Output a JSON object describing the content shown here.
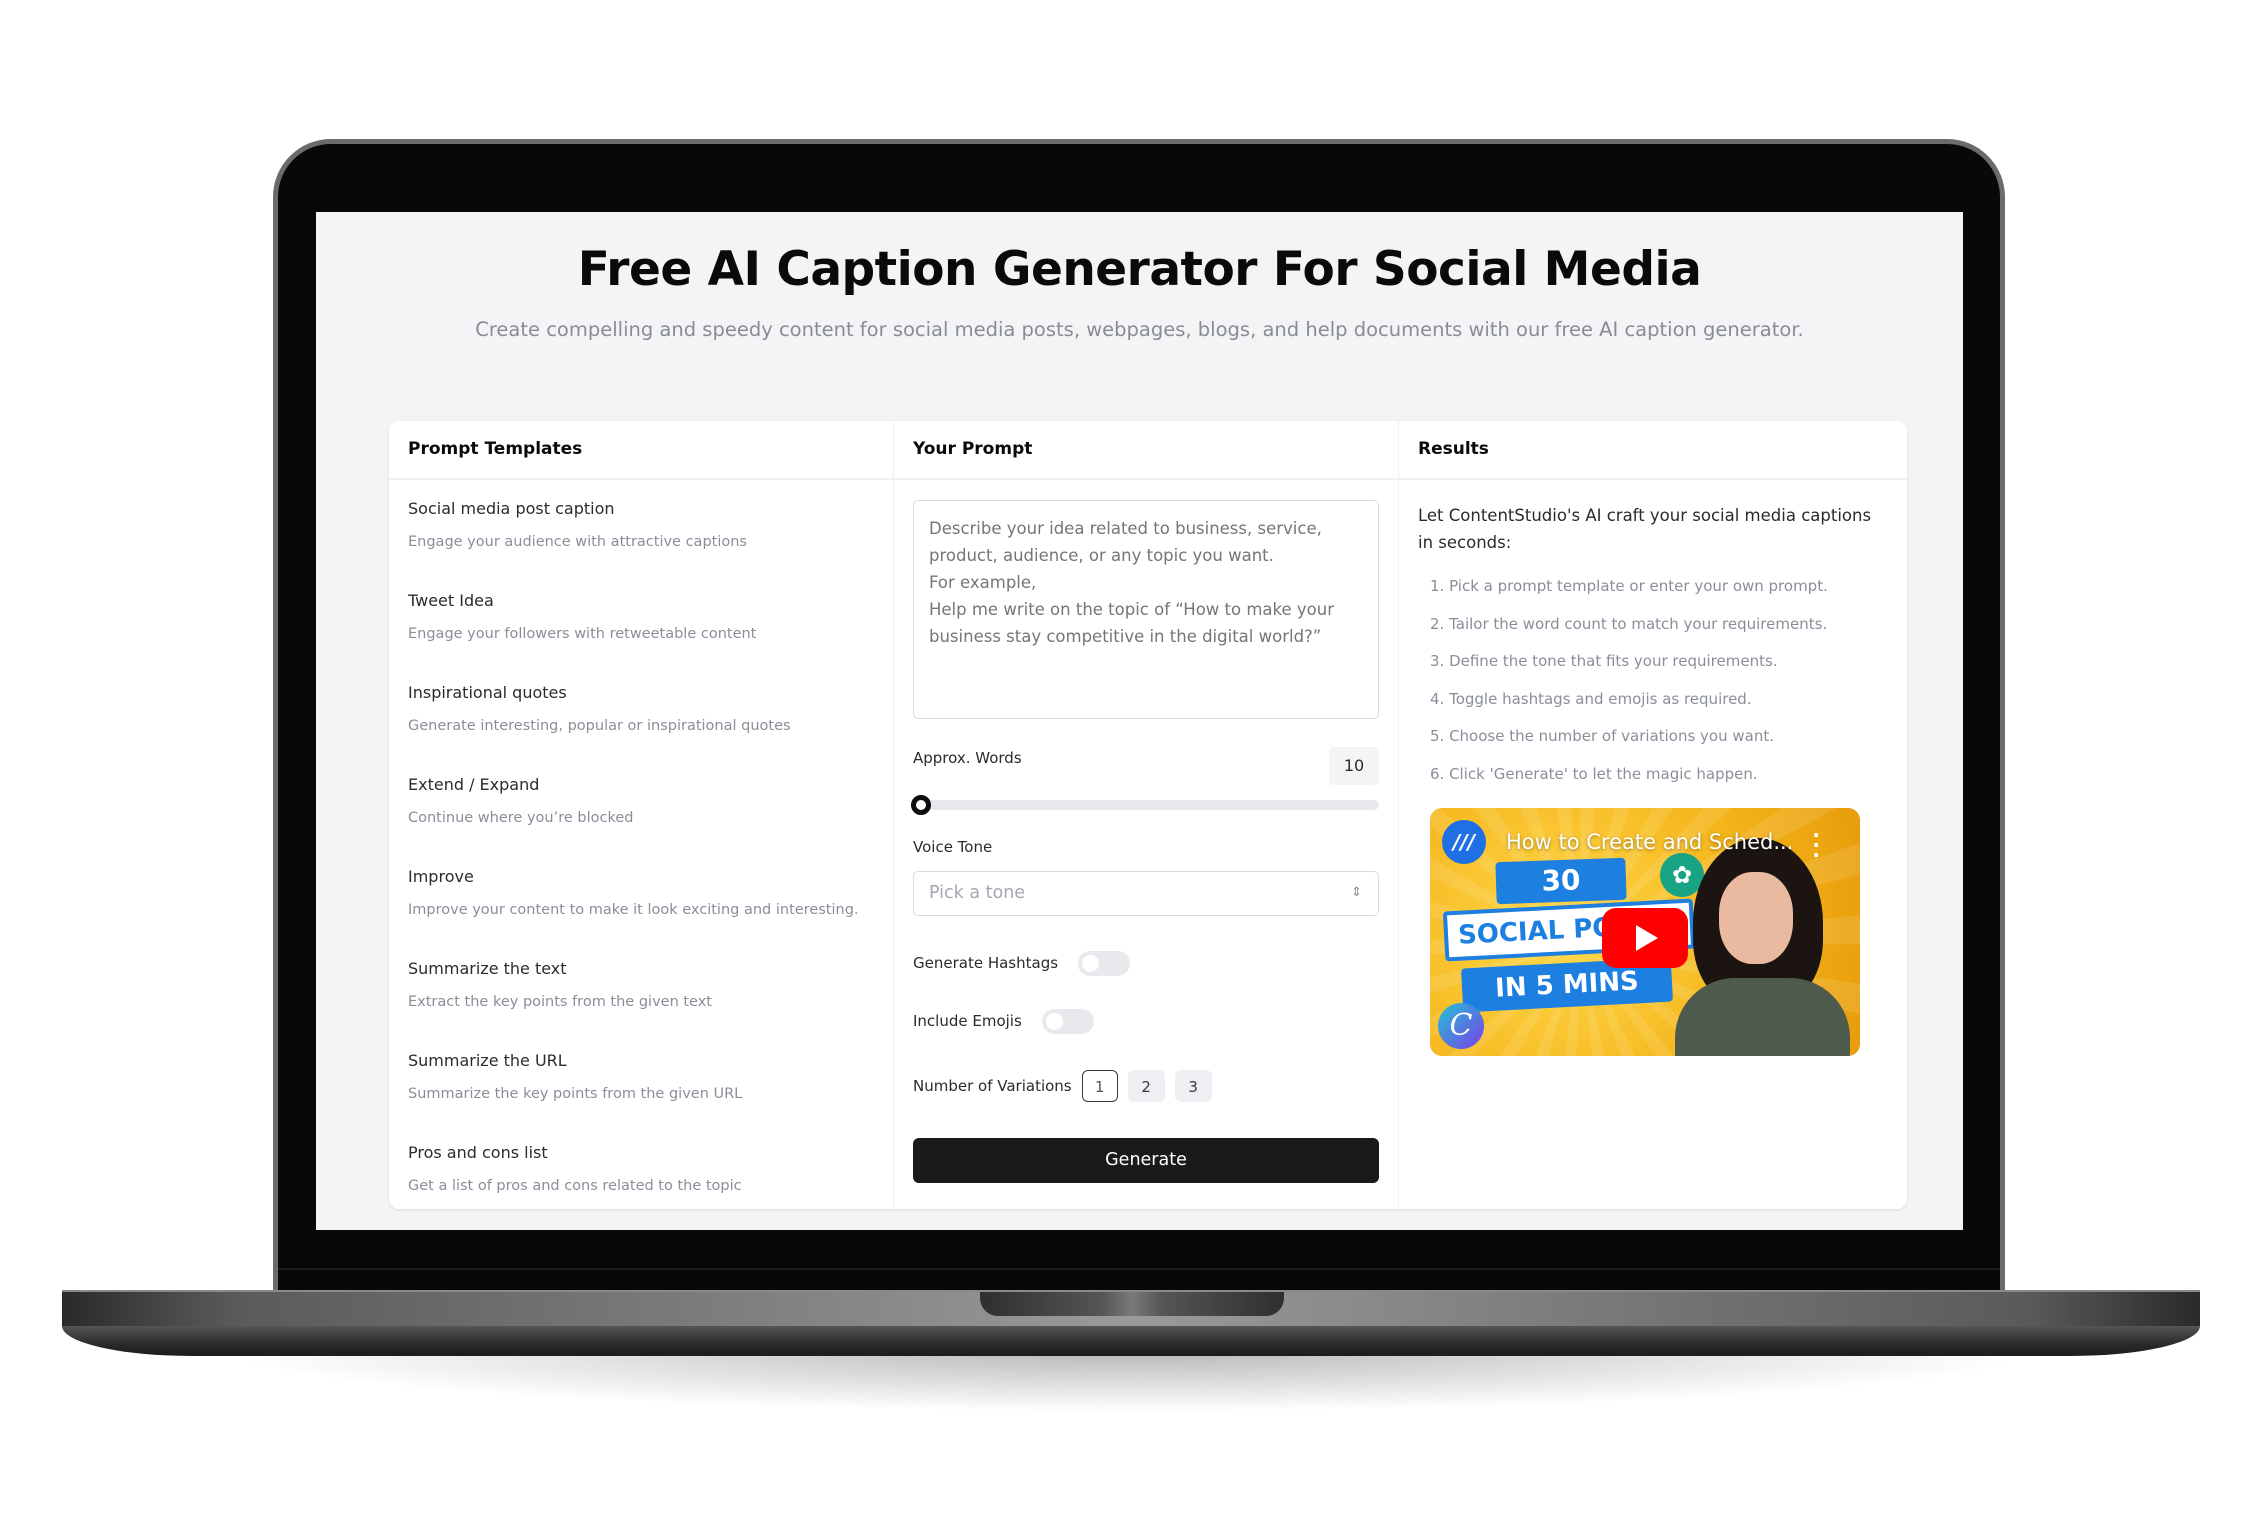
{
  "page": {
    "title": "Free AI Caption Generator For Social Media",
    "subtitle": "Create compelling and speedy content for social media posts, webpages, blogs, and help documents with our free AI caption generator."
  },
  "templates": {
    "heading": "Prompt Templates",
    "items": [
      {
        "title": "Social media post caption",
        "desc": "Engage your audience with attractive captions"
      },
      {
        "title": "Tweet Idea",
        "desc": "Engage your followers with retweetable content"
      },
      {
        "title": "Inspirational quotes",
        "desc": "Generate interesting, popular or inspirational quotes"
      },
      {
        "title": "Extend / Expand",
        "desc": "Continue where you’re blocked"
      },
      {
        "title": "Improve",
        "desc": "Improve your content to make it look exciting and interesting."
      },
      {
        "title": "Summarize the text",
        "desc": "Extract the key points from the given text"
      },
      {
        "title": "Summarize the URL",
        "desc": "Summarize the key points from the given URL"
      },
      {
        "title": "Pros and cons list",
        "desc": "Get a list of pros and cons related to the topic"
      }
    ]
  },
  "prompt": {
    "heading": "Your Prompt",
    "placeholder": "Describe your idea related to business, service, product, audience, or any topic you want.\nFor example,\nHelp me write on the topic of “How to make your business stay competitive in the digital world?”",
    "value": "",
    "words_label": "Approx. Words",
    "words_value": "10",
    "words_slider_fraction": 0.0,
    "tone_label": "Voice Tone",
    "tone_placeholder": "Pick a tone",
    "hashtags_label": "Generate Hashtags",
    "hashtags_on": false,
    "emojis_label": "Include Emojis",
    "emojis_on": false,
    "variations_label": "Number of Variations",
    "variations": [
      "1",
      "2",
      "3"
    ],
    "variations_selected": "1",
    "generate_label": "Generate"
  },
  "results": {
    "heading": "Results",
    "intro": "Let ContentStudio's AI craft your social media captions in seconds:",
    "steps": [
      "1. Pick a prompt template or enter your own prompt.",
      "2. Tailor the word count to match your requirements.",
      "3. Define the tone that fits your requirements.",
      "4. Toggle hashtags and emojis as required.",
      "5. Choose the number of variations you want.",
      "6. Click 'Generate' to let the magic happen."
    ],
    "video": {
      "title": "How to Create and Sched...",
      "thumb_text_1": "30",
      "thumb_text_2": "SOCIAL POSTS",
      "thumb_text_3": "IN 5 MINS",
      "play_color": "#ff0000"
    }
  },
  "colors": {
    "screen_bg": "#f3f4f6",
    "primary_button": "#1a1a1c",
    "muted_text": "#8a8e9a",
    "toggle_off": "#e7e9ec"
  }
}
